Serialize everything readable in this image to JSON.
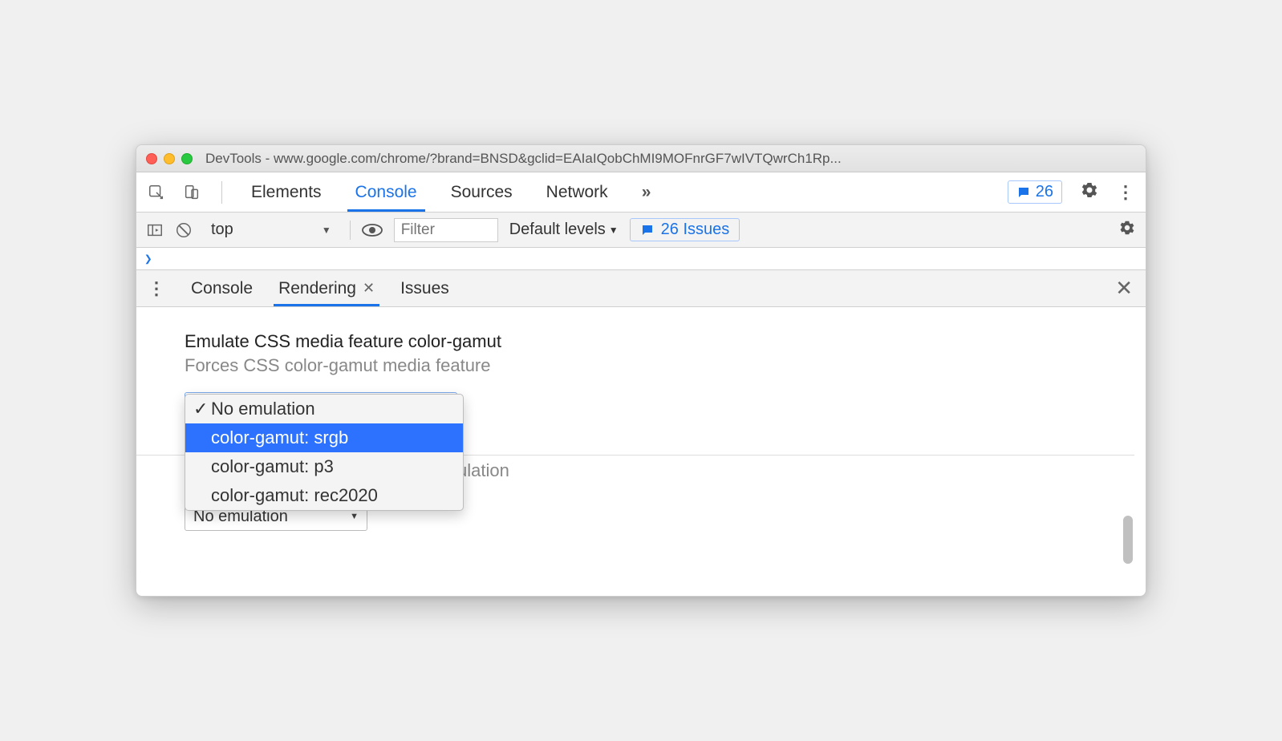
{
  "window": {
    "title": "DevTools - www.google.com/chrome/?brand=BNSD&gclid=EAIaIQobChMI9MOFnrGF7wIVTQwrCh1Rp..."
  },
  "main_tabs": {
    "items": [
      "Elements",
      "Console",
      "Sources",
      "Network"
    ],
    "active_index": 1,
    "overflow_glyph": "»",
    "issue_count": "26"
  },
  "console_toolbar": {
    "context": "top",
    "filter_placeholder": "Filter",
    "levels_label": "Default levels",
    "issues_label": "26 Issues"
  },
  "prompt_glyph": "❯",
  "drawer_tabs": {
    "items": [
      "Console",
      "Rendering",
      "Issues"
    ],
    "active_index": 1
  },
  "rendering": {
    "section_title": "Emulate CSS media feature color-gamut",
    "section_subtitle": "Forces CSS color-gamut media feature",
    "options": [
      "No emulation",
      "color-gamut: srgb",
      "color-gamut: p3",
      "color-gamut: rec2020"
    ],
    "checked_index": 0,
    "highlighted_index": 1,
    "obscured_text_fragment": "ulation",
    "secondary_select_value": "No emulation"
  }
}
